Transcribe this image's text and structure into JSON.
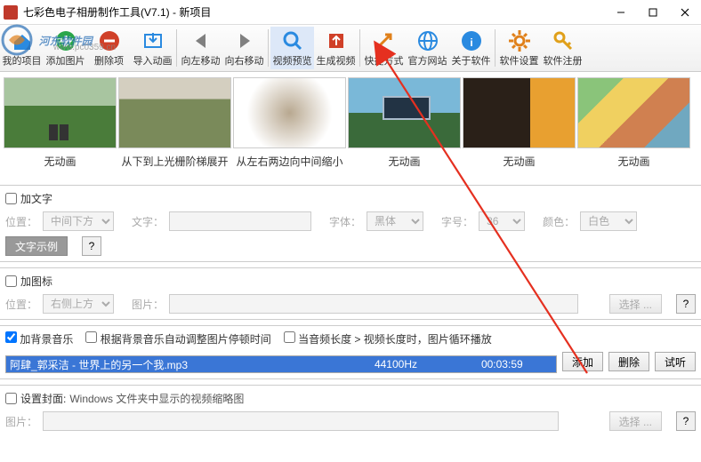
{
  "window": {
    "title": "七彩色电子相册制作工具(V7.1) - 新项目"
  },
  "toolbar": [
    {
      "label": "我的项目",
      "icon": "home-icon",
      "fill": "#2a8ae0"
    },
    {
      "label": "添加图片",
      "icon": "plus-icon",
      "fill": "#2aa64a"
    },
    {
      "label": "删除项",
      "icon": "minus-icon",
      "fill": "#d04028"
    },
    {
      "label": "导入动画",
      "icon": "import-icon",
      "fill": "#2a8ae0"
    },
    {
      "label": "向左移动",
      "icon": "arrow-left-icon",
      "fill": "#808080"
    },
    {
      "label": "向右移动",
      "icon": "arrow-right-icon",
      "fill": "#808080"
    },
    {
      "label": "视频预览",
      "icon": "search-icon",
      "fill": "#2a8ae0",
      "highlight": true
    },
    {
      "label": "生成视频",
      "icon": "export-icon",
      "fill": "#d04028"
    },
    {
      "label": "快捷方式",
      "icon": "shortcut-icon",
      "fill": "#e0801a"
    },
    {
      "label": "官方网站",
      "icon": "globe-icon",
      "fill": "#2a8ae0"
    },
    {
      "label": "关于软件",
      "icon": "info-icon",
      "fill": "#2a8ae0"
    },
    {
      "label": "软件设置",
      "icon": "gear-icon",
      "fill": "#e0801a"
    },
    {
      "label": "软件注册",
      "icon": "key-icon",
      "fill": "#e0a01a"
    }
  ],
  "thumbs": [
    {
      "caption": "无动画"
    },
    {
      "caption": "从下到上光栅阶梯展开"
    },
    {
      "caption": "从左右两边向中间缩小"
    },
    {
      "caption": "无动画"
    },
    {
      "caption": "无动画"
    },
    {
      "caption": "无动画"
    }
  ],
  "text_section": {
    "checkbox_label": "加文字",
    "pos_label": "位置：",
    "pos_value": "中间下方",
    "text_label": "文字：",
    "text_value": "",
    "font_label": "字体：",
    "font_value": "黑体",
    "size_label": "字号：",
    "size_value": "36",
    "color_label": "颜色：",
    "color_value": "白色",
    "example_btn": "文字示例",
    "help": "?"
  },
  "sticker_section": {
    "checkbox_label": "加图标",
    "pos_label": "位置：",
    "pos_value": "右侧上方",
    "path_label": "图片：",
    "path_value": "",
    "select_btn": "选择 ...",
    "help": "?"
  },
  "audio_section": {
    "checkbox_label": "加背景音乐",
    "opt1": "根据背景音乐自动调整图片停顿时间",
    "opt2": "当音频长度 > 视频长度时，图片循环播放",
    "file": {
      "name": "阿肆_郭采洁 - 世界上的另一个我.mp3",
      "rate": "44100Hz",
      "duration": "00:03:59"
    },
    "btn_add": "添加",
    "btn_del": "删除",
    "btn_play": "试听"
  },
  "cover_section": {
    "checkbox_label": "设置封面:",
    "desc": "Windows 文件夹中显示的视频缩略图",
    "path_label": "图片：",
    "path_value": "",
    "select_btn": "选择 ...",
    "help": "?"
  },
  "watermark": {
    "main": "河东软件园",
    "sub": "www.pc0359.cn"
  }
}
